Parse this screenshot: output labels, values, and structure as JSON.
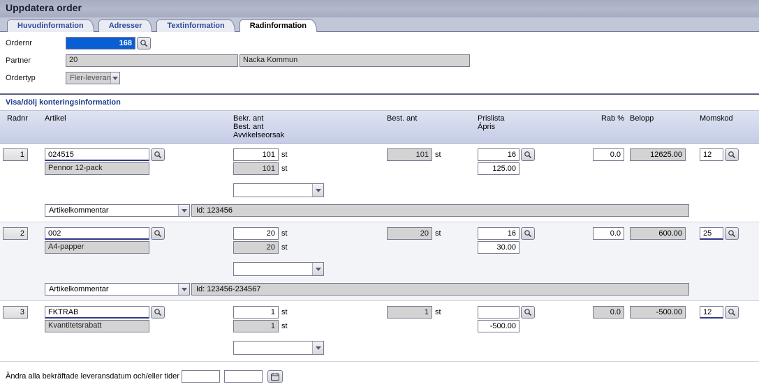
{
  "title": "Uppdatera order",
  "tabs": [
    "Huvudinformation",
    "Adresser",
    "Textinformation",
    "Radinformation"
  ],
  "active_tab": 3,
  "form": {
    "ordernr_label": "Ordernr",
    "ordernr": "168",
    "partner_label": "Partner",
    "partner_code": "20",
    "partner_name": "Nacka Kommun",
    "ordertyp_label": "Ordertyp",
    "ordertyp": "Fler-leverans"
  },
  "toggle_link": "Visa/dölj konteringsinformation",
  "columns": {
    "radnr": "Radnr",
    "artikel": "Artikel",
    "bekr": "Bekr. ant\nBest. ant\nAvvikelseorsak",
    "best": "Best. ant",
    "prislista": "Prislista\nÁpris",
    "rab": "Rab %",
    "belopp": "Belopp",
    "momskod": "Momskod"
  },
  "rows": [
    {
      "radnr": "1",
      "artikel": "024515",
      "artikel_desc": "Pennor 12-pack",
      "bekr_ant": "101",
      "best_ant_line2": "101",
      "unit": "st",
      "best_ant": "101",
      "prislista": "16",
      "apris": "125.00",
      "rab": "0.0",
      "rab_ro": false,
      "belopp": "12625.00",
      "momskod": "12",
      "moms_hl": false,
      "comment_label": "Artikelkommentar",
      "comment_id": "Id: 123456"
    },
    {
      "radnr": "2",
      "artikel": "002",
      "artikel_desc": "A4-papper",
      "bekr_ant": "20",
      "best_ant_line2": "20",
      "unit": "st",
      "best_ant": "20",
      "prislista": "16",
      "apris": "30.00",
      "rab": "0.0",
      "rab_ro": false,
      "belopp": "600.00",
      "momskod": "25",
      "moms_hl": true,
      "comment_label": "Artikelkommentar",
      "comment_id": "Id: 123456-234567"
    },
    {
      "radnr": "3",
      "artikel": "FKTRAB",
      "artikel_desc": "Kvantitetsrabatt",
      "bekr_ant": "1",
      "best_ant_line2": "1",
      "unit": "st",
      "best_ant": "1",
      "prislista": "",
      "apris": "-500.00",
      "rab": "0.0",
      "rab_ro": true,
      "belopp": "-500.00",
      "momskod": "12",
      "moms_hl": true,
      "comment_label": "",
      "comment_id": ""
    }
  ],
  "footer": {
    "label": "Ändra alla bekräftade leveransdatum och/eller tider"
  }
}
